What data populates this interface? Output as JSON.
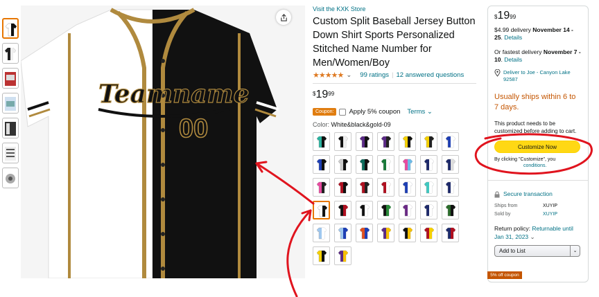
{
  "product": {
    "store_link": "Visit the KXK Store",
    "title": "Custom Split Baseball Jersey Button Down Shirt Sports Personalized Stitched Name Number for Men/Women/Boy",
    "stars": "★★★★★",
    "rating_caret": "⌄",
    "ratings": "99 ratings",
    "rating_sep": "|",
    "answered": "12 answered questions",
    "price_symbol": "$",
    "price_whole": "19",
    "price_fraction": "99",
    "coupon_badge": "Coupon:",
    "coupon_label": "Apply 5% coupon",
    "terms": "Terms ⌄",
    "color_label": "Color:",
    "color_value": "White&black&gold-09",
    "jersey_text": "Teamname",
    "jersey_number": "00"
  },
  "swatches": [
    {
      "a": "#2bb3a0",
      "b": "#111"
    },
    {
      "a": "#111",
      "b": "#eee"
    },
    {
      "a": "#5b2a86",
      "b": "#111"
    },
    {
      "a": "#5b2a86",
      "b": "#222"
    },
    {
      "a": "#f5d000",
      "b": "#111"
    },
    {
      "a": "#f5d000",
      "b": "#222"
    },
    {
      "a": "#1e3fb4",
      "b": "#fff"
    },
    {
      "a": "#1e3fb4",
      "b": "#111"
    },
    {
      "a": "#ccc",
      "b": "#111"
    },
    {
      "a": "#0c6b5b",
      "b": "#111"
    },
    {
      "a": "#1a7a3a",
      "b": "#fff"
    },
    {
      "a": "#e84aa0",
      "b": "#6bbbe8"
    },
    {
      "a": "#1e2a6b",
      "b": "#fff"
    },
    {
      "a": "#1e2a6b",
      "b": "#ddd"
    },
    {
      "a": "#e84aa0",
      "b": "#222"
    },
    {
      "a": "#b01020",
      "b": "#111"
    },
    {
      "a": "#b01020",
      "b": "#222"
    },
    {
      "a": "#b01020",
      "b": "#fff"
    },
    {
      "a": "#1e3fb4",
      "b": "#fff"
    },
    {
      "a": "#40c8c0",
      "b": "#fff"
    },
    {
      "a": "#1e2a6b",
      "b": "#fff"
    },
    {
      "a": "#fff",
      "b": "#111"
    },
    {
      "a": "#111",
      "b": "#b01020"
    },
    {
      "a": "#111",
      "b": "#fff"
    },
    {
      "a": "#111",
      "b": "#2a8a3a"
    },
    {
      "a": "#6b2a86",
      "b": "#fff"
    },
    {
      "a": "#1e2a6b",
      "b": "#fff"
    },
    {
      "a": "#2a6b2a",
      "b": "#111"
    },
    {
      "a": "#9fc8ef",
      "b": "#fff"
    },
    {
      "a": "#9fc8ef",
      "b": "#1e3fb4"
    },
    {
      "a": "#e05020",
      "b": "#1e3fb4"
    },
    {
      "a": "#5b2a86",
      "b": "#f5c000"
    },
    {
      "a": "#111",
      "b": "#f5c000"
    },
    {
      "a": "#b01020",
      "b": "#f5d000"
    },
    {
      "a": "#1e2a6b",
      "b": "#b01020"
    },
    {
      "a": "#f5d000",
      "b": "#111"
    },
    {
      "a": "#5b2a86",
      "b": "#f5c000"
    }
  ],
  "buybox": {
    "price_symbol": "$",
    "price_whole": "19",
    "price_fraction": "99",
    "delivery_prefix": "$4.99 delivery ",
    "delivery_date": "November 14 - 25",
    "delivery_suffix": ". ",
    "details": "Details",
    "fastest_prefix": "Or fastest delivery ",
    "fastest_date": "November 7 - 10",
    "fastest_suffix": ". ",
    "fastest_details": "Details",
    "deliver_to": "Deliver to Joe - Canyon Lake 92587",
    "ships_warning": "Usually ships within 6 to 7 days.",
    "customize_note": "This product needs to be customized before adding to cart.",
    "customize_button": "Customize Now",
    "by_clicking": "By clicking \"Customize\", you",
    "conditions": "conditions.",
    "secure": "Secure transaction",
    "ships_from_label": "Ships from",
    "ships_from_value": "XUYIP",
    "sold_by_label": "Sold by",
    "sold_by_value": "XUYIP",
    "return_prefix": "Return policy: ",
    "return_link": "Returnable until Jan 31, 2023",
    "return_caret": "⌄",
    "add_to_list": "Add to List",
    "add_caret": "⌄",
    "off_coupon": "5% off coupon"
  }
}
